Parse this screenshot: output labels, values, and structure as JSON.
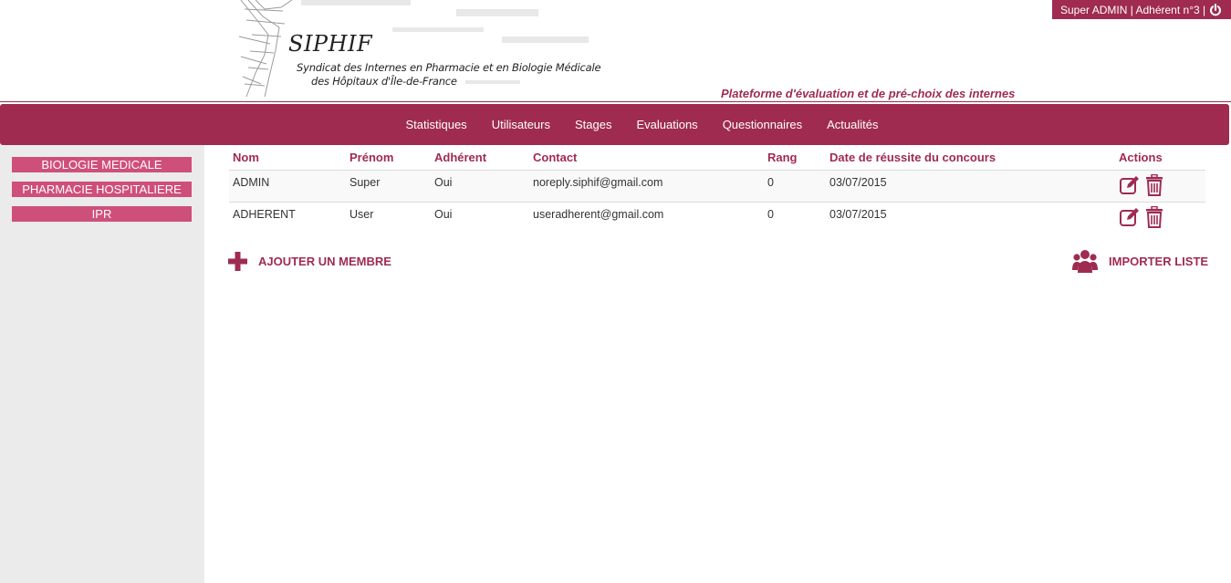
{
  "brand": {
    "logo_title": "SIPHIF",
    "logo_line1": "Syndicat des Internes en Pharmacie et en Biologie Médicale",
    "logo_line2": "des Hôpitaux d'Île-de-France",
    "tagline": "Plateforme d'évaluation et de pré-choix des internes"
  },
  "user_box": {
    "label": "Super ADMIN | Adhérent n°3 |",
    "logout_icon": "power-icon"
  },
  "nav": {
    "items": [
      "Statistiques",
      "Utilisateurs",
      "Stages",
      "Evaluations",
      "Questionnaires",
      "Actualités"
    ]
  },
  "sidebar": {
    "items": [
      "BIOLOGIE MEDICALE",
      "PHARMACIE HOSPITALIERE",
      "IPR"
    ]
  },
  "table": {
    "headers": {
      "nom": "Nom",
      "prenom": "Prénom",
      "adherent": "Adhérent",
      "contact": "Contact",
      "rang": "Rang",
      "date": "Date de réussite du concours",
      "actions": "Actions"
    },
    "rows": [
      {
        "nom": "ADMIN",
        "prenom": "Super",
        "adherent": "Oui",
        "contact": "noreply.siphif@gmail.com",
        "rang": "0",
        "date": "03/07/2015"
      },
      {
        "nom": "ADHERENT",
        "prenom": "User",
        "adherent": "Oui",
        "contact": "useradherent@gmail.com",
        "rang": "0",
        "date": "03/07/2015"
      }
    ]
  },
  "actions": {
    "add_member": "AJOUTER UN MEMBRE",
    "import_list": "IMPORTER LISTE"
  },
  "colors": {
    "accent": "#9f2b51",
    "sidebar_button": "#cf4f7b",
    "sidebar_bg": "#ebebeb"
  }
}
